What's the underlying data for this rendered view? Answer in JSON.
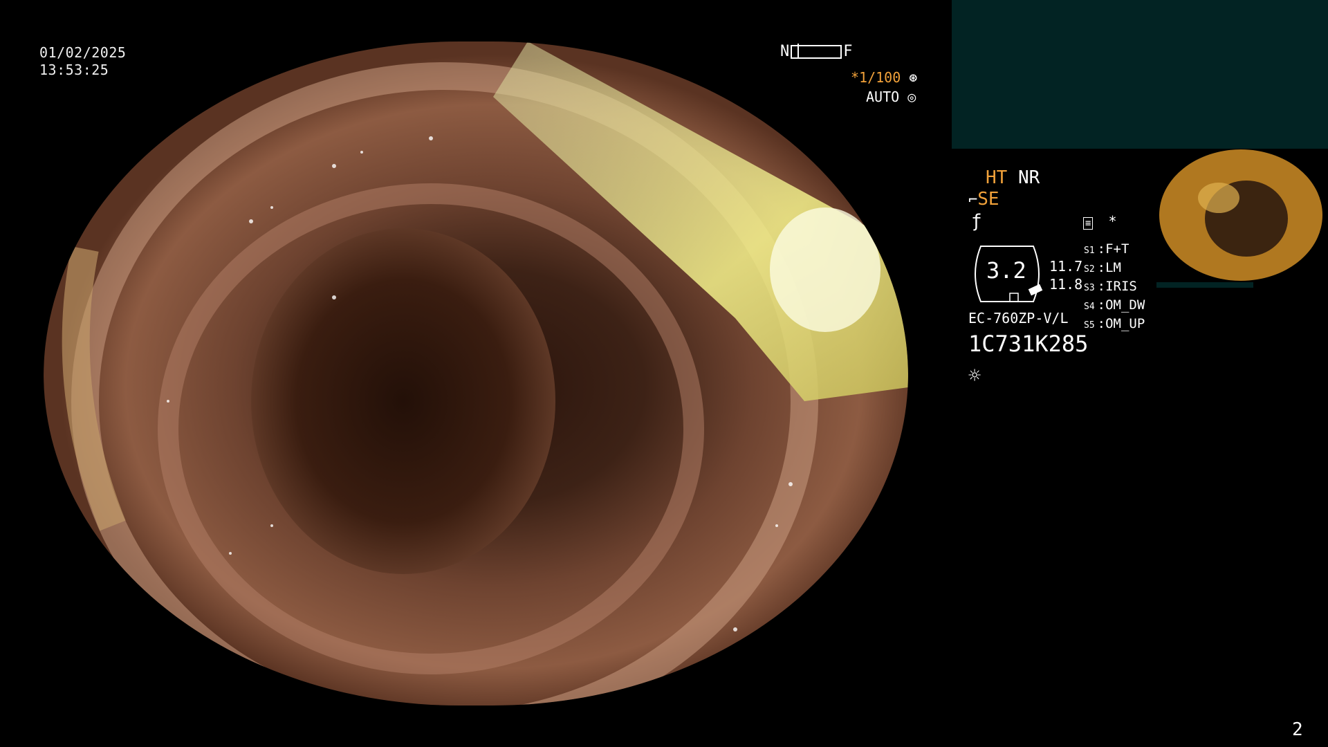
{
  "datetime": {
    "date": "01/02/2025",
    "time": "13:53:25"
  },
  "focus_scale": {
    "near": "N",
    "far": "F"
  },
  "shutter": "*1/100",
  "iris_mode": "AUTO",
  "modes": {
    "ht": "HT",
    "nr": "NR",
    "se": "SE",
    "asterisk": "*"
  },
  "zoom": {
    "value": "3.2",
    "values": [
      "11.7",
      "11.8"
    ]
  },
  "scope_model": "EC-760ZP-V/L",
  "serial": "1C731K285",
  "switches": [
    {
      "key": "S1",
      "label": "F+T"
    },
    {
      "key": "S2",
      "label": "LM"
    },
    {
      "key": "S3",
      "label": "IRIS"
    },
    {
      "key": "S4",
      "label": "OM_DW"
    },
    {
      "key": "S5",
      "label": "OM_UP"
    }
  ],
  "page_number": "2",
  "icons": [
    "shutter-icon",
    "auto-iris-icon",
    "snare-icon",
    "function-icon",
    "settings-icon",
    "light-icon"
  ],
  "colors": {
    "accent": "#f2a23a",
    "panel": "#022323",
    "tissue": "#7a4a35"
  }
}
